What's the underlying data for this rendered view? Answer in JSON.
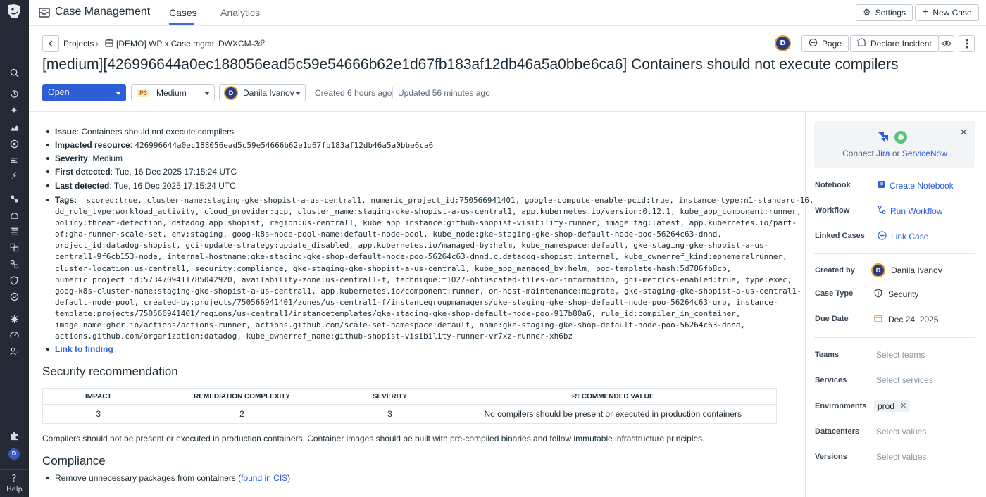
{
  "topbar": {
    "app_title": "Case Management",
    "tabs": [
      {
        "label": "Cases"
      },
      {
        "label": "Analytics"
      }
    ],
    "settings_label": "Settings",
    "new_case_label": "New Case"
  },
  "leftnav": {
    "icons": [
      "logo-icon",
      "search-icon",
      "recent-icon",
      "star-icon",
      "dashboard-icon",
      "monitor-icon",
      "apm-icon",
      "bolt-icon",
      "infrastructure-icon",
      "security-icon",
      "logs-icon",
      "integrations-icon",
      "network-icon",
      "shield-icon",
      "synthetics-icon",
      "bug-icon",
      "performance-icon",
      "rum-icon",
      "puzzle-icon",
      "user-avatar-icon",
      "help-icon"
    ],
    "help_label": "Help"
  },
  "breadcrumb": {
    "items": [
      "Projects",
      "[DEMO] WP x Case mgmt",
      "DWXCM-3"
    ]
  },
  "header_actions": {
    "page_label": "Page",
    "declare_label": "Declare Incident"
  },
  "case": {
    "title": "[medium][426996644a0ec188056ead5c59e54666b62e1d67fb183af12db46a5a0bbe6ca6] Containers should not execute compilers",
    "status": "Open",
    "priority_badge": "P3",
    "priority": "Medium",
    "assignee": "Danila Ivanov",
    "created": "Created 6 hours ago",
    "updated": "Updated 56 minutes ago"
  },
  "details": {
    "issue_label": "Issue",
    "issue_value": "Containers should not execute compilers",
    "resource_label": "Impacted resource",
    "resource_value": "426996644a0ec188056ead5c59e54666b62e1d67fb183af12db46a5a0bbe6ca6",
    "severity_label": "Severity",
    "severity_value": "Medium",
    "first_label": "First detected",
    "first_value": "Tue, 16 Dec 2025 17:15:24 UTC",
    "last_label": "Last detected",
    "last_value": "Tue, 16 Dec 2025 17:15:24 UTC",
    "tags_label": "Tags",
    "tags_lines": [
      "scored:true, cluster-name:staging-gke-shopist-a-us-central1, numeric_project_id:750566941401, google-compute-enable-pcid:true, instance-type:n1-standard-16,",
      "dd_rule_type:workload_activity, cloud_provider:gcp, cluster_name:staging-gke-shopist-a-us-central1, app.kubernetes.io/version:0.12.1, kube_app_component:runner,",
      "policy:threat-detection, datadog_app:shopist, region:us-central1, kube_app_instance:github-shopist-visibility-runner, image_tag:latest, app.kubernetes.io/part-",
      "of:gha-runner-scale-set, env:staging, goog-k8s-node-pool-name:default-node-pool, kube_node:gke-staging-gke-shop-default-node-poo-56264c63-dnnd,",
      "project_id:datadog-shopist, gci-update-strategy:update_disabled, app.kubernetes.io/managed-by:helm, kube_namespace:default, gke-staging-gke-shopist-a-us-",
      "central1-9f6cb153-node, internal-hostname:gke-staging-gke-shop-default-node-poo-56264c63-dnnd.c.datadog-shopist.internal, kube_ownerref_kind:ephemeralrunner,",
      "cluster-location:us-central1, security:compliance, gke-staging-gke-shopist-a-us-central1, kube_app_managed_by:helm, pod-template-hash:5d786fb8cb,",
      "numeric_project_id:5734709411785042920, availability-zone:us-central1-f, technique:t1027-obfuscated-files-or-information, gci-metrics-enabled:true, type:exec,",
      "goog-k8s-cluster-name:staging-gke-shopist-a-us-central1, app.kubernetes.io/component:runner, on-host-maintenance:migrate, gke-staging-gke-shopist-a-us-central1-",
      "default-node-pool, created-by:projects/750566941401/zones/us-central1-f/instancegroupmanagers/gke-staging-gke-shop-default-node-poo-56264c63-grp, instance-",
      "template:projects/750566941401/regions/us-central1/instancetemplates/gke-staging-gke-shop-default-node-poo-917b80a6, rule_id:compiler_in_container,",
      "image_name:ghcr.io/actions/actions-runner, actions.github.com/scale-set-namespace:default, name:gke-staging-gke-shop-default-node-poo-56264c63-dnnd,",
      "actions.github.com/organization:datadog, kube_ownerref_name:github-shopist-visibility-runner-vr7xz-runner-xh6bz"
    ],
    "link_label": "Link to finding"
  },
  "recommendation": {
    "heading": "Security recommendation",
    "columns": [
      "IMPACT",
      "REMEDIATION COMPLEXITY",
      "SEVERITY",
      "RECOMMENDED VALUE"
    ],
    "row": [
      "3",
      "2",
      "3",
      "No compilers should be present or executed in production containers"
    ],
    "paragraph": "Compilers should not be present or executed in production containers. Container images should be built with pre-compiled binaries and follow immutable infrastructure principles."
  },
  "compliance": {
    "heading": "Compliance",
    "item_text": "Remove unnecessary packages from containers (",
    "item_link": "found in CIS",
    "item_end": ")"
  },
  "sidebar": {
    "connect_prefix": "Connect ",
    "connect_jira": "Jira",
    "connect_or": " or ",
    "connect_servicenow": "ServiceNow",
    "notebook_label": "Notebook",
    "notebook_action": "Create Notebook",
    "workflow_label": "Workflow",
    "workflow_action": "Run Workflow",
    "linked_label": "Linked Cases",
    "linked_action": "Link Case",
    "created_by_label": "Created by",
    "created_by_value": "Danila Ivanov",
    "case_type_label": "Case Type",
    "case_type_value": "Security",
    "due_label": "Due Date",
    "due_value": "Dec 24, 2025",
    "teams_label": "Teams",
    "teams_placeholder": "Select teams",
    "services_label": "Services",
    "services_placeholder": "Select services",
    "env_label": "Environments",
    "env_chip": "prod",
    "dc_label": "Datacenters",
    "dc_placeholder": "Select values",
    "versions_label": "Versions",
    "versions_placeholder": "Select values"
  },
  "colors": {
    "accent": "#2e5ed6",
    "nav_bg": "#232a35",
    "priority_badge": "#f5a623"
  }
}
